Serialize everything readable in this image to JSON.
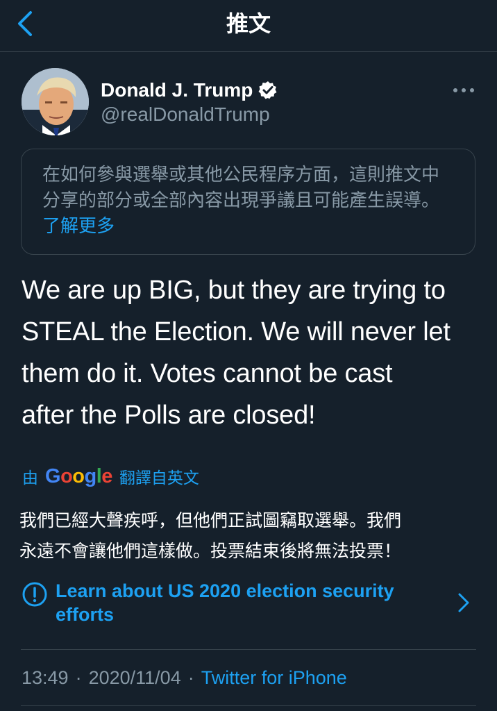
{
  "header": {
    "title": "推文",
    "back_icon": "chevron-left-icon"
  },
  "tweet": {
    "author_name": "Donald J. Trump",
    "author_handle": "@realDonaldTrump",
    "verified_icon": "verified-badge-icon",
    "more_icon": "more-options-icon",
    "notice": {
      "text": "在如何參與選舉或其他公民程序方面，這則推文中分享的部分或全部內容出現爭議且可能產生誤導。",
      "link": "了解更多"
    },
    "text_lines": [
      "We are up BIG, but they are trying to",
      "STEAL the Election. We will never let",
      "them do it. Votes cannot be cast",
      "after the Polls are closed!"
    ],
    "translation": {
      "prefix": "由",
      "brand": "Google",
      "suffix": "翻譯自英文",
      "lines": [
        "我們已經大聲疾呼，但他們正試圖竊取選舉。我們",
        "永遠不會讓他們這樣做。投票結束後將無法投票！"
      ]
    },
    "election_notice": {
      "icon": "info-icon",
      "line1": "Learn about US 2020 election security",
      "line2": "efforts",
      "chevron_icon": "chevron-right-icon"
    },
    "meta": {
      "time": "13:49",
      "separator": "·",
      "date": "2020/11/04",
      "source": "Twitter for iPhone"
    }
  },
  "colors": {
    "background": "#15202b",
    "accent": "#1da1f2",
    "secondary_text": "#8899a6",
    "border": "#38444d"
  }
}
